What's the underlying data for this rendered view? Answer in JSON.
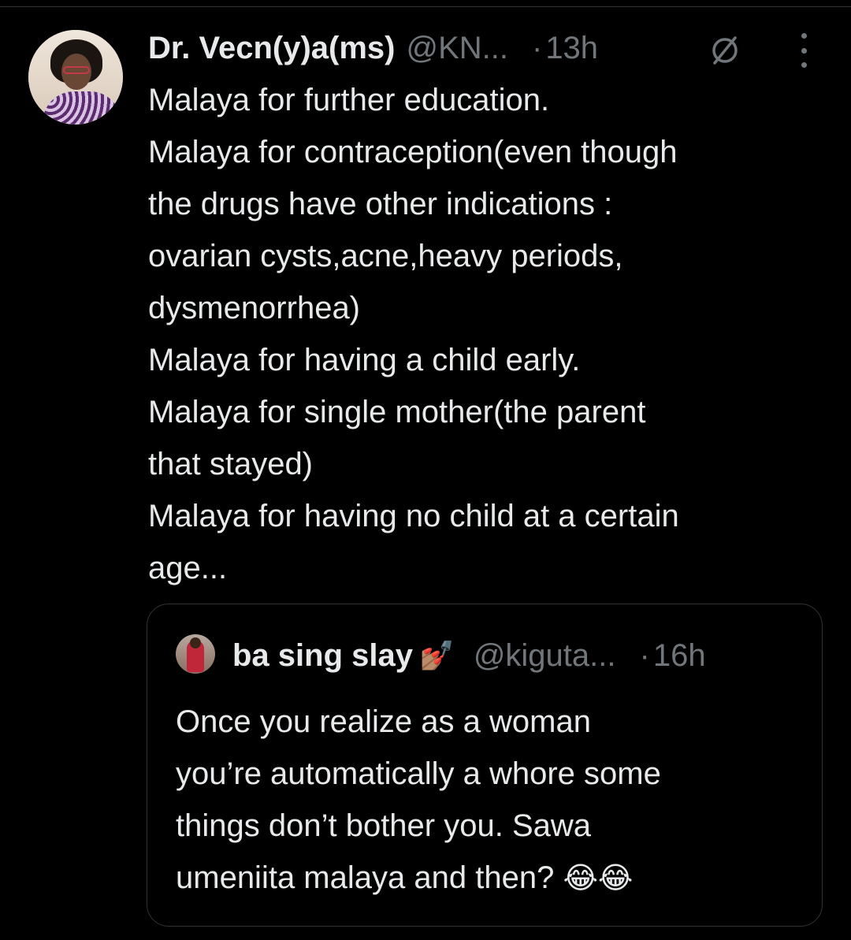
{
  "tweet": {
    "display_name": "Dr. Vecn(y)a(ms)",
    "handle": "@KN...",
    "separator": "·",
    "time": "13h",
    "lines": [
      "Malaya for further education.",
      "Malaya for contraception(even though",
      "the drugs have other indications :",
      "ovarian cysts,acne,heavy periods,",
      "dysmenorrhea)",
      "Malaya for having a child early.",
      "Malaya for single mother(the parent",
      "that stayed)",
      "Malaya for having no child at a certain",
      "age..."
    ]
  },
  "quote": {
    "display_name": "ba sing slay",
    "name_emoji": "💅🏽",
    "handle": "@kiguta...",
    "separator": "·",
    "time": "16h",
    "lines": [
      "Once you realize as a woman",
      "you’re automatically a whore some",
      "things don’t bother you. Sawa",
      "umeniita malaya and then?"
    ],
    "trailing_emoji": "😂😂"
  },
  "icons": {
    "avatar": "profile-photo",
    "no_sign": "circle-slash-icon",
    "more": "vertical-ellipsis-icon"
  },
  "colors": {
    "background": "#000000",
    "text": "#e7e9ea",
    "secondary": "#71767b",
    "border": "#2f3336"
  }
}
